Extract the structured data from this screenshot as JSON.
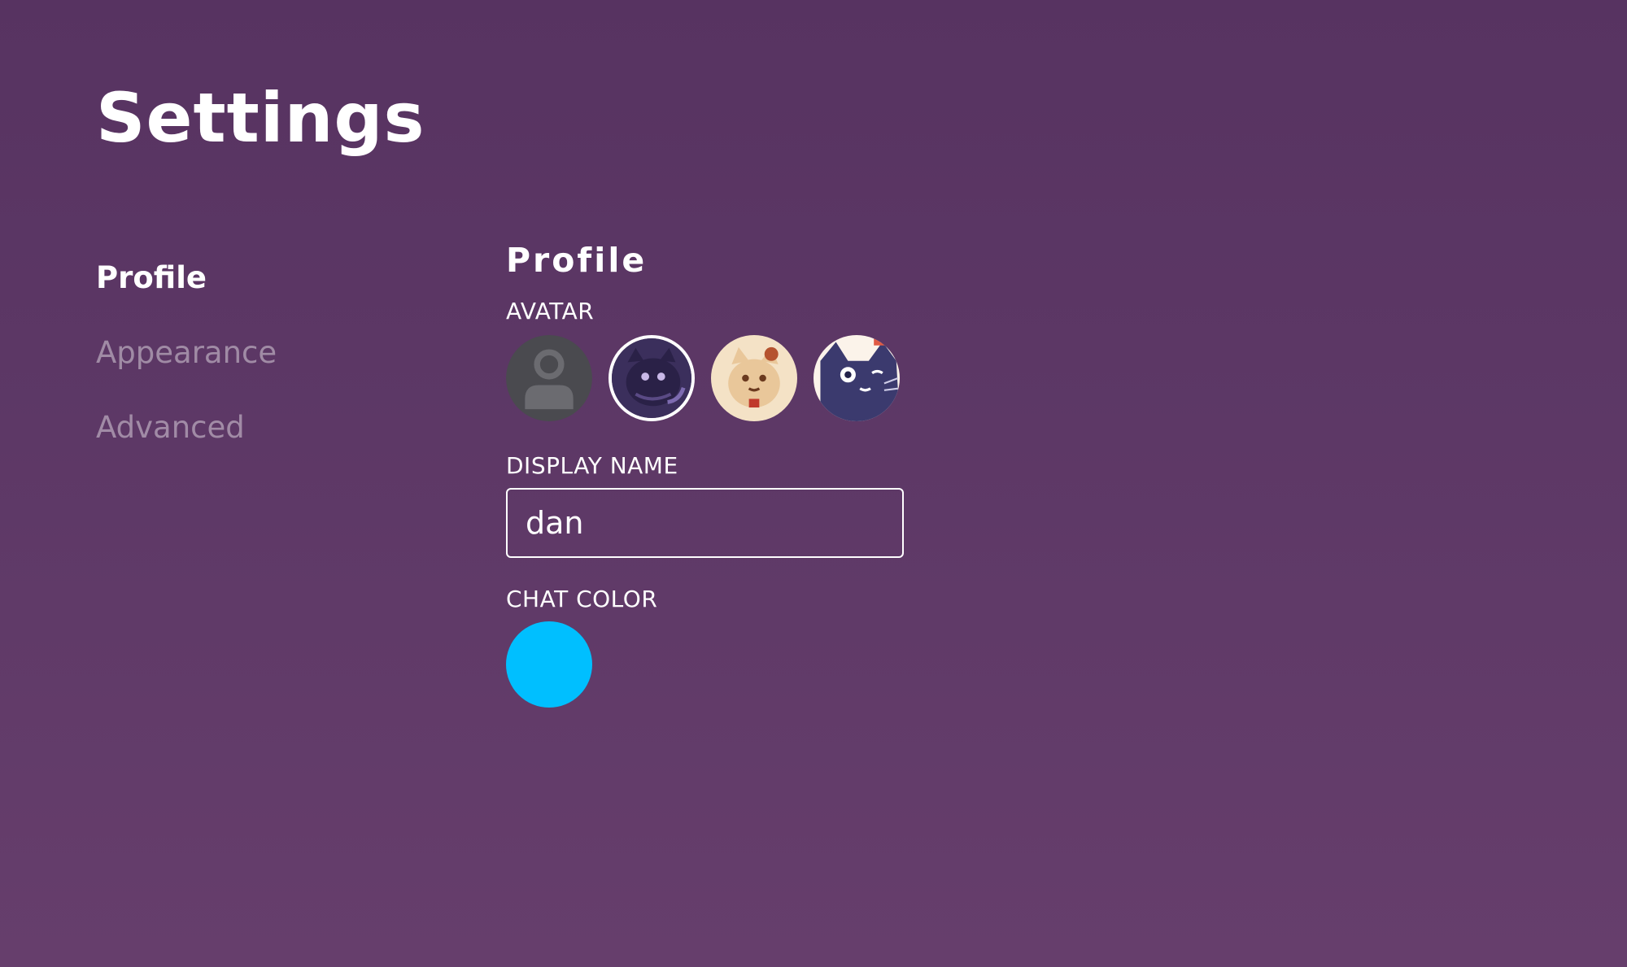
{
  "page": {
    "title": "Settings"
  },
  "sidebar": {
    "items": [
      {
        "label": "Profile",
        "active": true
      },
      {
        "label": "Appearance",
        "active": false
      },
      {
        "label": "Advanced",
        "active": false
      }
    ]
  },
  "profile": {
    "heading": "Profile",
    "avatar_label": "AVATAR",
    "avatars": [
      {
        "icon": "default-user-icon",
        "selected": false
      },
      {
        "icon": "purple-cat-avatar",
        "selected": true
      },
      {
        "icon": "cream-cat-avatar",
        "selected": false
      },
      {
        "icon": "navy-cat-avatar",
        "selected": false
      }
    ],
    "display_name_label": "DISPLAY NAME",
    "display_name_value": "dan",
    "chat_color_label": "CHAT COLOR",
    "chat_color": "#00bfff"
  },
  "colors": {
    "background": "#5d3866",
    "text": "#ffffff",
    "inactive_text": "rgba(255,255,255,0.42)"
  }
}
